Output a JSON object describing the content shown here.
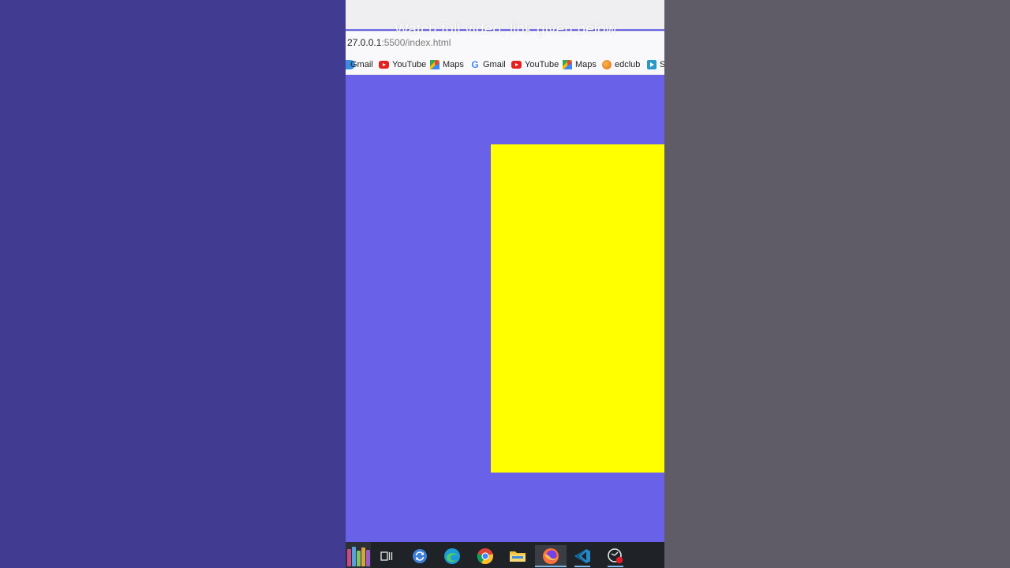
{
  "overlay_caption": "Watch full video, link given below",
  "browser": {
    "url_host": "27.0.0.1",
    "url_path": ":5500/index.html"
  },
  "bookmarks": [
    {
      "label": "Gmail",
      "icon": "google-icon"
    },
    {
      "label": "YouTube",
      "icon": "youtube-icon"
    },
    {
      "label": "Maps",
      "icon": "maps-icon"
    },
    {
      "label": "Gmail",
      "icon": "google-icon"
    },
    {
      "label": "YouTube",
      "icon": "youtube-icon"
    },
    {
      "label": "Maps",
      "icon": "maps-icon"
    },
    {
      "label": "edclub",
      "icon": "edclub-icon"
    },
    {
      "label": "S",
      "icon": "bookmark-icon"
    }
  ],
  "page": {
    "background_color": "#6962e8",
    "box_color": "#ffff00"
  },
  "taskbar": {
    "apps": [
      {
        "name": "library-books-icon"
      },
      {
        "name": "task-view-icon"
      },
      {
        "name": "sync-icon"
      },
      {
        "name": "edge-icon"
      },
      {
        "name": "chrome-icon"
      },
      {
        "name": "file-explorer-icon"
      },
      {
        "name": "firefox-icon",
        "active": true
      },
      {
        "name": "vscode-icon"
      },
      {
        "name": "screen-recorder-icon"
      }
    ]
  }
}
